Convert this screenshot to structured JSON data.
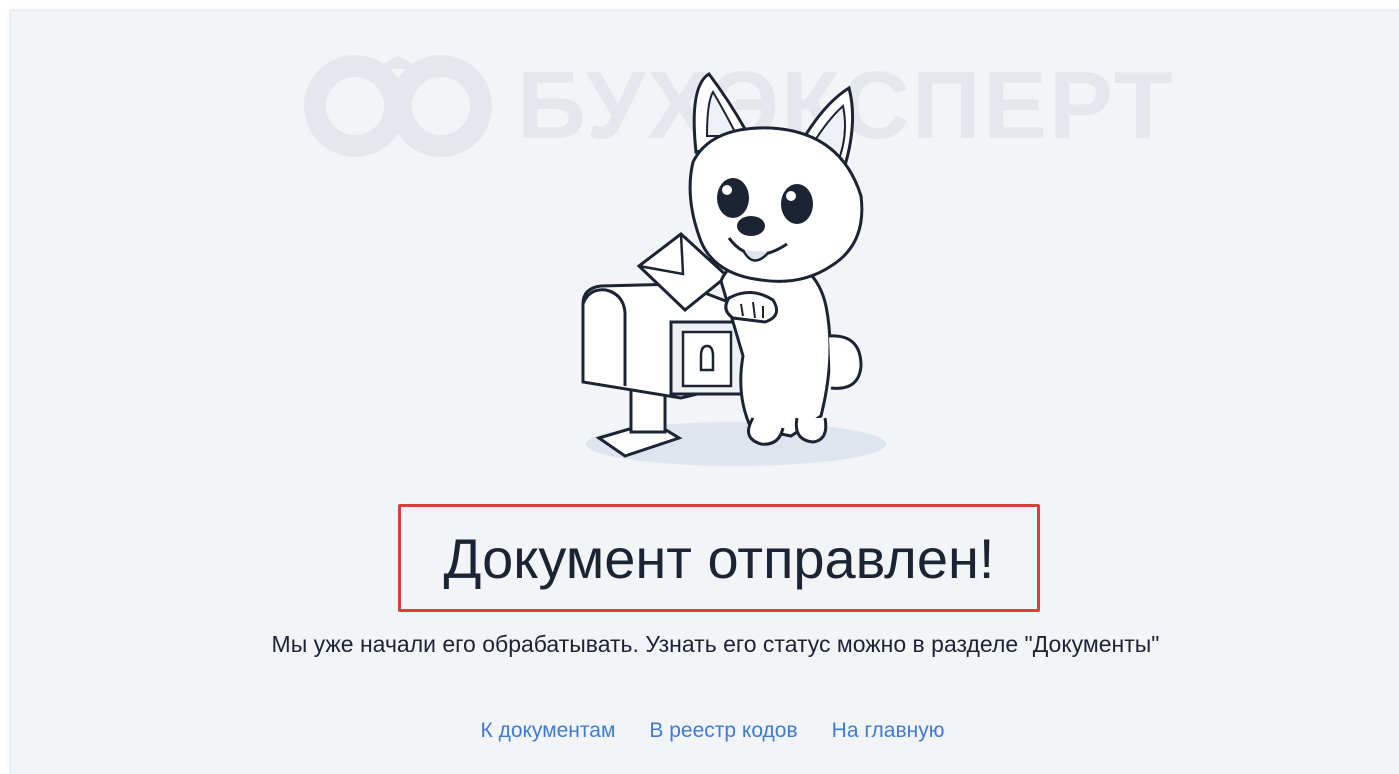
{
  "watermark": {
    "text": "БУХЭКСПЕРТ"
  },
  "illustration": {
    "icon": "corgi-mailbox-illustration"
  },
  "title": "Документ отправлен!",
  "subtitle": "Мы уже начали его обрабатывать. Узнать его статус можно в разделе \"Документы\"",
  "links": [
    {
      "label": "К документам"
    },
    {
      "label": "В реестр кодов"
    },
    {
      "label": "На главную"
    }
  ],
  "colors": {
    "background": "#f2f4f8",
    "text": "#1c2433",
    "link": "#3f7bd0",
    "highlight_border": "#d9403a"
  }
}
